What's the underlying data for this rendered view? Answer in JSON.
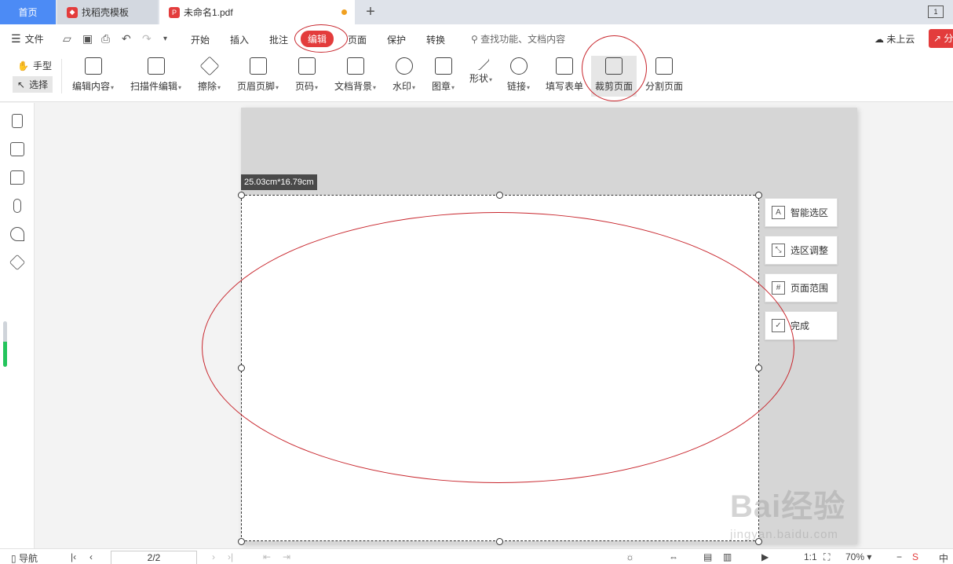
{
  "tabs": {
    "home": "首页",
    "template": "找稻壳模板",
    "file": "未命名1.pdf"
  },
  "menu": {
    "file": "文件",
    "tabs": [
      "开始",
      "插入",
      "批注",
      "编辑",
      "页面",
      "保护",
      "转换"
    ],
    "search_placeholder": "查找功能、文档内容",
    "cloud": "未上云",
    "share": "分"
  },
  "ribbon": {
    "hand": "手型",
    "select": "选择",
    "tools": [
      "编辑内容",
      "扫描件编辑",
      "擦除",
      "页眉页脚",
      "页码",
      "文档背景",
      "水印",
      "图章",
      "形状",
      "链接",
      "填写表单",
      "裁剪页面",
      "分割页面"
    ]
  },
  "document": {
    "size_label": "25.03cm*16.79cm"
  },
  "crop_actions": [
    "智能选区",
    "选区调整",
    "页面范围",
    "完成"
  ],
  "statusbar": {
    "nav": "导航",
    "page": "2/2",
    "zoom": "70%",
    "ime": "中"
  },
  "watermark": {
    "main": "Bai经验",
    "sub": "jingyan.baidu.com"
  },
  "colors": {
    "accent": "#e33c3c",
    "home_tab": "#4c8bf5",
    "annotation": "#c8262d"
  }
}
